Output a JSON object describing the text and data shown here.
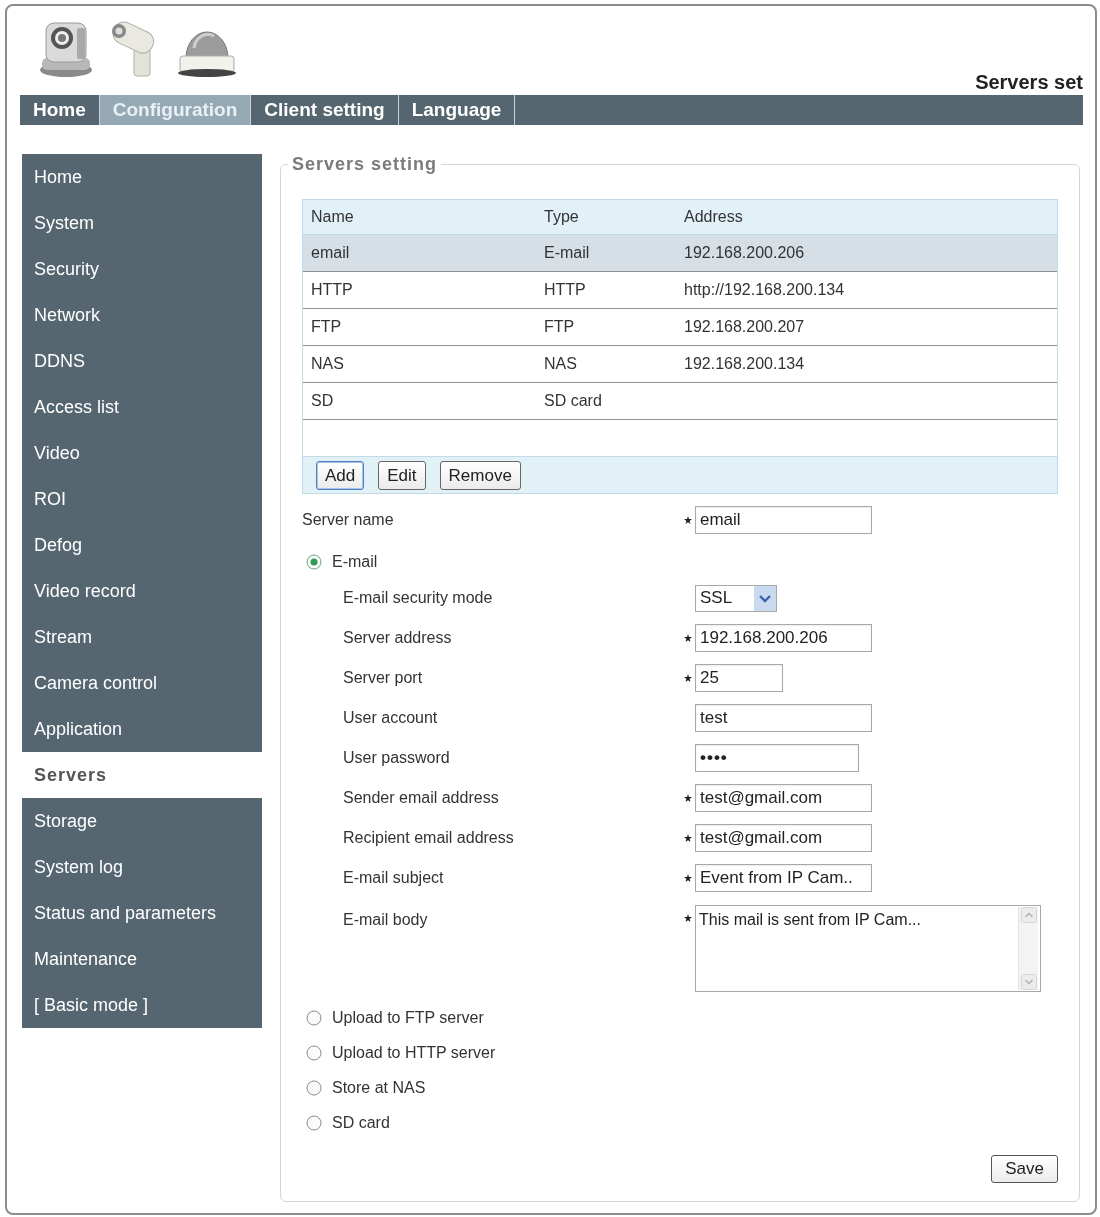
{
  "header": {
    "title": "Servers set"
  },
  "nav_tabs": [
    {
      "label": "Home",
      "selected": false
    },
    {
      "label": "Configuration",
      "selected": true
    },
    {
      "label": "Client setting",
      "selected": false
    },
    {
      "label": "Language",
      "selected": false
    }
  ],
  "sidebar": {
    "items": [
      {
        "label": "Home",
        "selected": false
      },
      {
        "label": "System",
        "selected": false
      },
      {
        "label": "Security",
        "selected": false
      },
      {
        "label": "Network",
        "selected": false
      },
      {
        "label": "DDNS",
        "selected": false
      },
      {
        "label": "Access list",
        "selected": false
      },
      {
        "label": "Video",
        "selected": false
      },
      {
        "label": "ROI",
        "selected": false
      },
      {
        "label": "Defog",
        "selected": false
      },
      {
        "label": "Video record",
        "selected": false
      },
      {
        "label": "Stream",
        "selected": false
      },
      {
        "label": "Camera control",
        "selected": false
      },
      {
        "label": "Application",
        "selected": false
      },
      {
        "label": "Servers",
        "selected": true
      },
      {
        "label": "Storage",
        "selected": false
      },
      {
        "label": "System log",
        "selected": false
      },
      {
        "label": "Status and parameters",
        "selected": false
      },
      {
        "label": "Maintenance",
        "selected": false
      },
      {
        "label": "[ Basic mode ]",
        "selected": false
      }
    ]
  },
  "servers_setting": {
    "legend": "Servers setting",
    "table": {
      "columns": [
        "Name",
        "Type",
        "Address"
      ],
      "rows": [
        {
          "cells": [
            "email",
            "E-mail",
            "192.168.200.206"
          ],
          "selected": true
        },
        {
          "cells": [
            "HTTP",
            "HTTP",
            "http://192.168.200.134"
          ],
          "selected": false
        },
        {
          "cells": [
            "FTP",
            "FTP",
            "192.168.200.207"
          ],
          "selected": false
        },
        {
          "cells": [
            "NAS",
            "NAS",
            "192.168.200.134"
          ],
          "selected": false
        },
        {
          "cells": [
            "SD",
            "SD card"
          ],
          "selected": false
        }
      ]
    },
    "table_buttons": [
      {
        "label": "Add",
        "focused": true
      },
      {
        "label": "Edit",
        "focused": false
      },
      {
        "label": "Remove",
        "focused": false
      }
    ],
    "server_name": {
      "label": "Server name",
      "kind": "text",
      "value": "email",
      "required": true
    },
    "modes": [
      {
        "label": "E-mail",
        "selected": true,
        "fields": [
          {
            "label": "E-mail security mode",
            "kind": "select",
            "value": "SSL",
            "required": false
          },
          {
            "label": "Server address",
            "kind": "text",
            "value": "192.168.200.206",
            "required": true
          },
          {
            "label": "Server port",
            "kind": "number",
            "value": "25",
            "required": true
          },
          {
            "label": "User account",
            "kind": "text",
            "value": "test",
            "required": false
          },
          {
            "label": "User password",
            "kind": "password",
            "value": "••••",
            "required": false
          },
          {
            "label": "Sender email address",
            "kind": "text",
            "value": "test@gmail.com",
            "required": true
          },
          {
            "label": "Recipient email address",
            "kind": "text",
            "value": "test@gmail.com",
            "required": true
          },
          {
            "label": "E-mail subject",
            "kind": "text",
            "value": "Event from IP Cam..",
            "required": true
          },
          {
            "label": "E-mail body",
            "kind": "textarea",
            "value": "This mail is sent from IP Cam...",
            "required": true
          }
        ]
      },
      {
        "label": "Upload to FTP server",
        "selected": false
      },
      {
        "label": "Upload to HTTP server",
        "selected": false
      },
      {
        "label": "Store at NAS",
        "selected": false
      },
      {
        "label": "SD card",
        "selected": false
      }
    ],
    "save_button": "Save"
  }
}
